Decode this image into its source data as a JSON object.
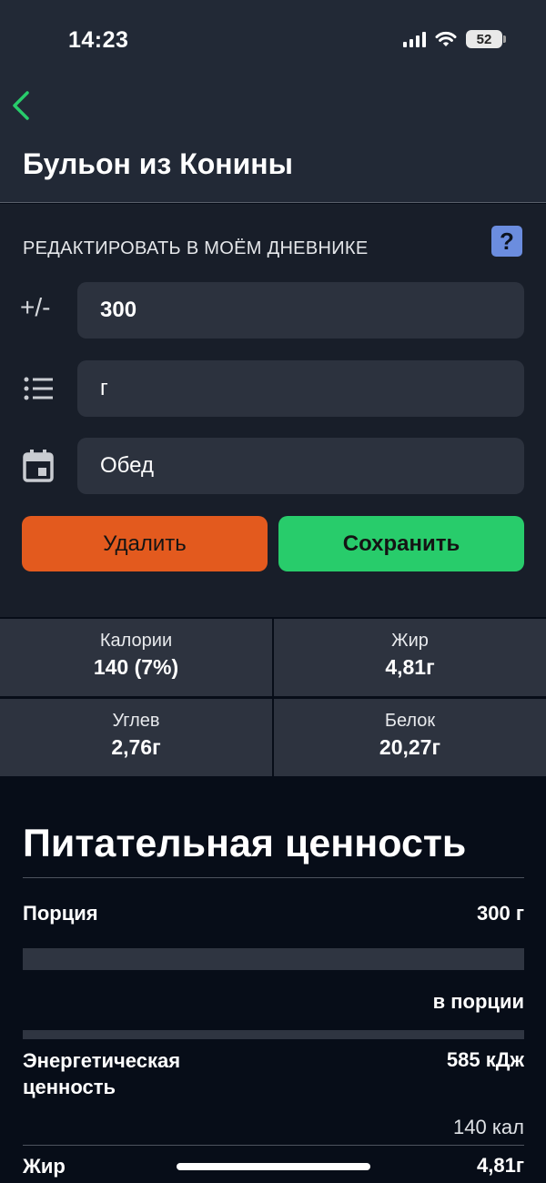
{
  "status_bar": {
    "time": "14:23",
    "battery": "52"
  },
  "header": {
    "title": "Бульон из Конины"
  },
  "editor": {
    "section_label": "РЕДАКТИРОВАТЬ В МОЁМ ДНЕВНИКЕ",
    "help_label": "?",
    "amount_icon_text": "+/-",
    "amount_value": "300",
    "unit_value": "г",
    "meal_value": "Обед",
    "delete_label": "Удалить",
    "save_label": "Сохранить"
  },
  "stats": [
    {
      "label": "Калории",
      "value": "140 (7%)"
    },
    {
      "label": "Жир",
      "value": "4,81г"
    },
    {
      "label": "Углев",
      "value": "2,76г"
    },
    {
      "label": "Белок",
      "value": "20,27г"
    }
  ],
  "nutrition": {
    "title": "Питательная ценность",
    "portion_label": "Порция",
    "portion_value": "300 г",
    "per_portion_label": "в порции",
    "energy_label": "Энергетическая ценность",
    "energy_kj": "585 кДж",
    "energy_kcal": "140 кал",
    "fat_label": "Жир",
    "fat_value": "4,81г"
  },
  "colors": {
    "header_bg": "#222936",
    "editor_bg": "#181e29",
    "page_bg": "#070d18",
    "accent_green": "#28cc6b",
    "accent_orange": "#e35a1e",
    "help_blue": "#6b8ddf"
  },
  "icons": [
    "chevron-left-icon",
    "signal-icon",
    "wifi-icon",
    "battery-icon",
    "help-icon",
    "plus-minus-icon",
    "list-icon",
    "calendar-icon"
  ]
}
